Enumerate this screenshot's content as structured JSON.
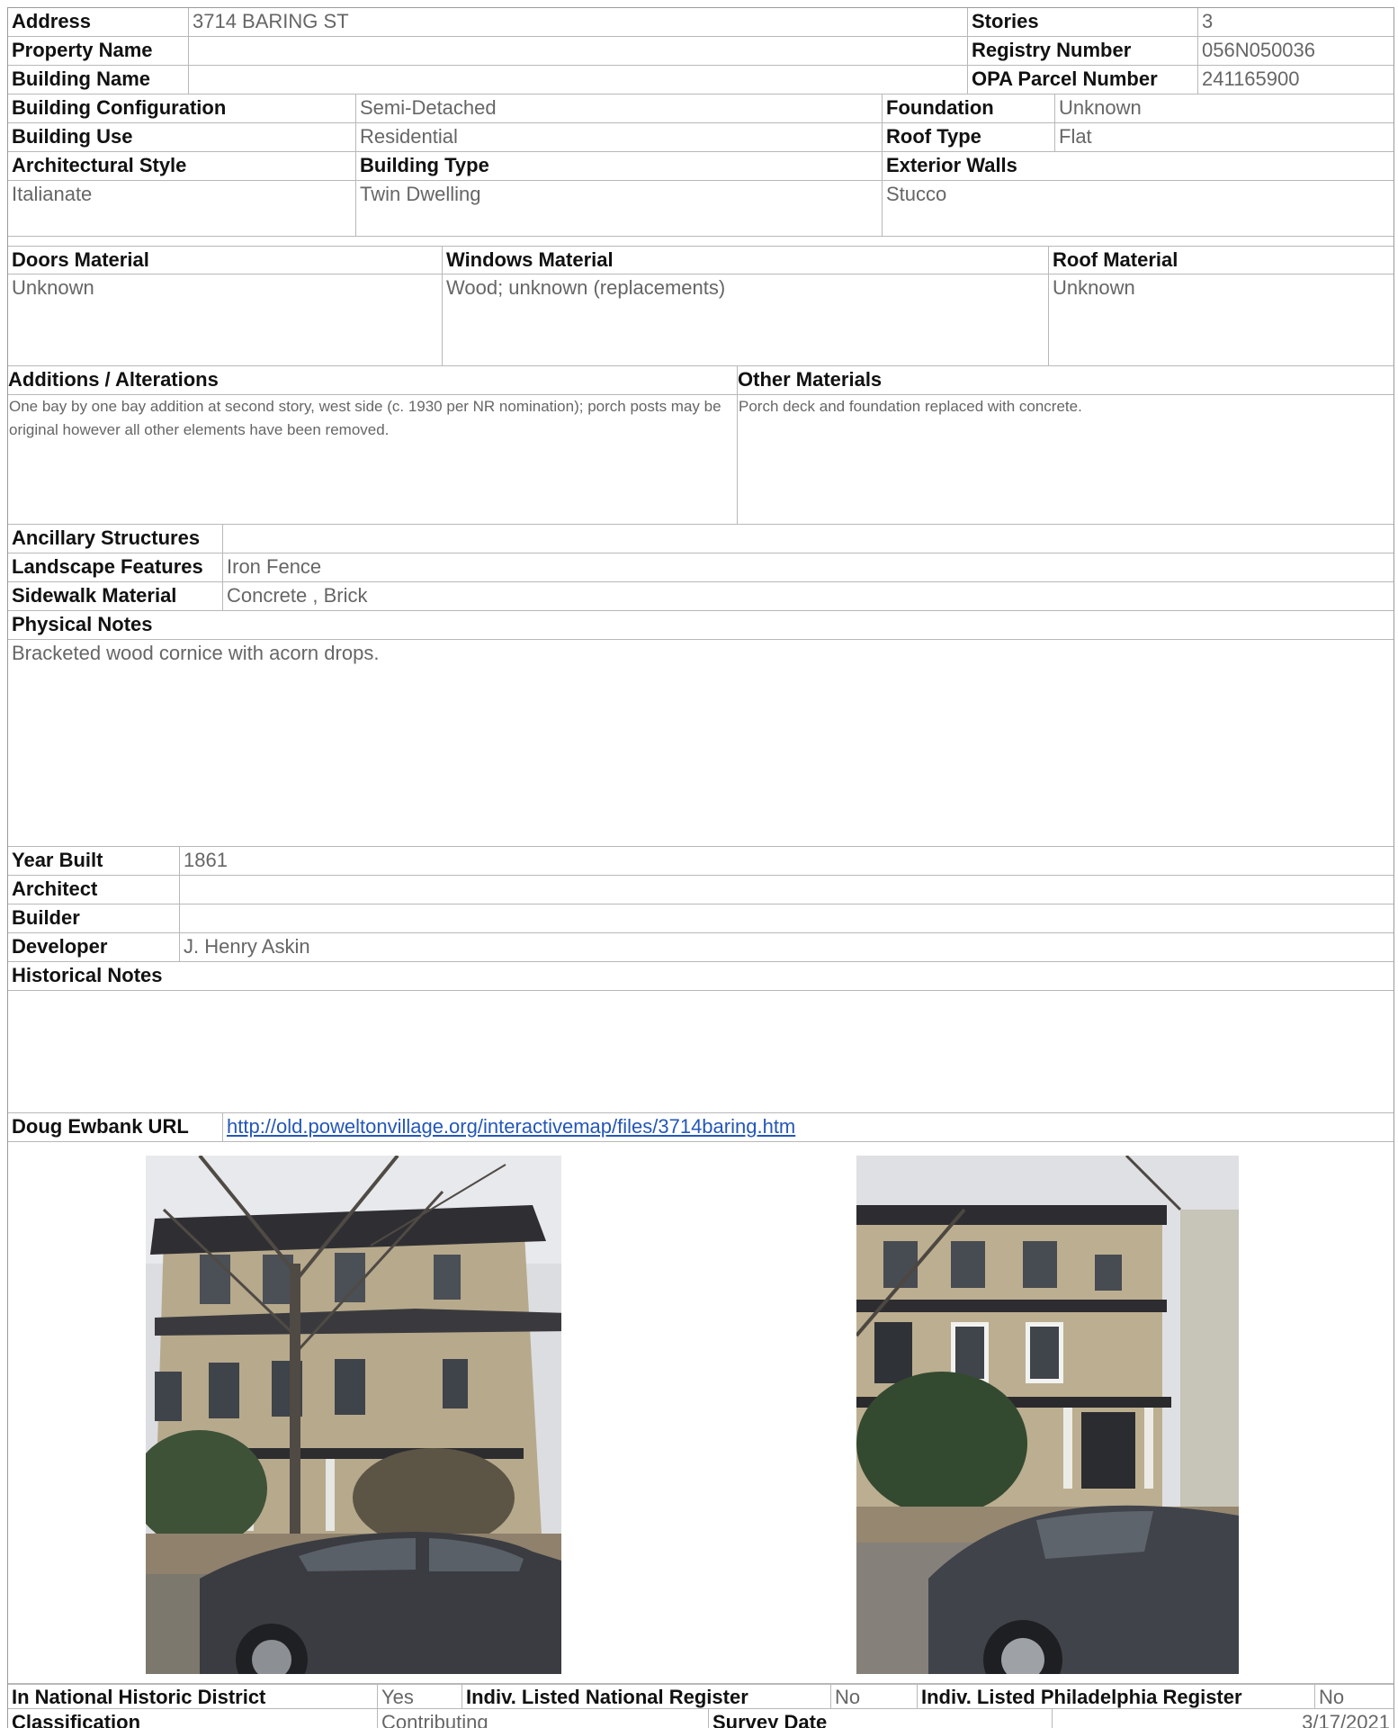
{
  "address": {
    "label": "Address",
    "value": "3714 BARING ST"
  },
  "stories": {
    "label": "Stories",
    "value": "3"
  },
  "property_name": {
    "label": "Property Name",
    "value": ""
  },
  "registry_number": {
    "label": "Registry Number",
    "value": "056N050036"
  },
  "building_name": {
    "label": "Building Name",
    "value": ""
  },
  "opa_parcel": {
    "label": "OPA Parcel Number",
    "value": "241165900"
  },
  "building_configuration": {
    "label": "Building Configuration",
    "value": "Semi-Detached"
  },
  "foundation": {
    "label": "Foundation",
    "value": "Unknown"
  },
  "building_use": {
    "label": "Building Use",
    "value": "Residential"
  },
  "roof_type": {
    "label": "Roof Type",
    "value": "Flat"
  },
  "architectural_style": {
    "label": "Architectural Style",
    "value": "Italianate"
  },
  "building_type": {
    "label": "Building Type",
    "value": "Twin Dwelling"
  },
  "exterior_walls": {
    "label": "Exterior Walls",
    "value": "Stucco"
  },
  "doors_material": {
    "label": "Doors Material",
    "value": "Unknown"
  },
  "windows_material": {
    "label": "Windows Material",
    "value": "Wood; unknown (replacements)"
  },
  "roof_material": {
    "label": "Roof Material",
    "value": "Unknown"
  },
  "additions": {
    "label": "Additions / Alterations",
    "value": "One bay by one bay addition at second story, west side (c. 1930 per NR nomination); porch posts may be original however all other elements have been removed."
  },
  "other_materials": {
    "label": "Other Materials",
    "value": "Porch deck and foundation replaced with concrete."
  },
  "ancillary_structures": {
    "label": "Ancillary Structures",
    "value": ""
  },
  "landscape_features": {
    "label": "Landscape Features",
    "value": "Iron Fence"
  },
  "sidewalk_material": {
    "label": "Sidewalk Material",
    "value": "Concrete , Brick"
  },
  "physical_notes": {
    "label": "Physical Notes",
    "value": "Bracketed wood cornice with acorn drops."
  },
  "year_built": {
    "label": "Year Built",
    "value": "1861"
  },
  "architect": {
    "label": "Architect",
    "value": ""
  },
  "builder": {
    "label": "Builder",
    "value": ""
  },
  "developer": {
    "label": "Developer",
    "value": "J. Henry Askin"
  },
  "historical_notes": {
    "label": "Historical Notes",
    "value": ""
  },
  "ewbank_url": {
    "label": "Doug Ewbank URL",
    "value": "http://old.poweltonvillage.org/interactivemap/files/3714baring.htm"
  },
  "national_district": {
    "label": "In National Historic District",
    "value": "Yes"
  },
  "national_register": {
    "label": "Indiv. Listed National Register",
    "value": "No"
  },
  "philadelphia_register": {
    "label": "Indiv. Listed Philadelphia Register",
    "value": "No"
  },
  "classification": {
    "label": "Classification",
    "value": "Contributing"
  },
  "survey_date": {
    "label": "Survey Date",
    "value": "3/17/2021"
  }
}
